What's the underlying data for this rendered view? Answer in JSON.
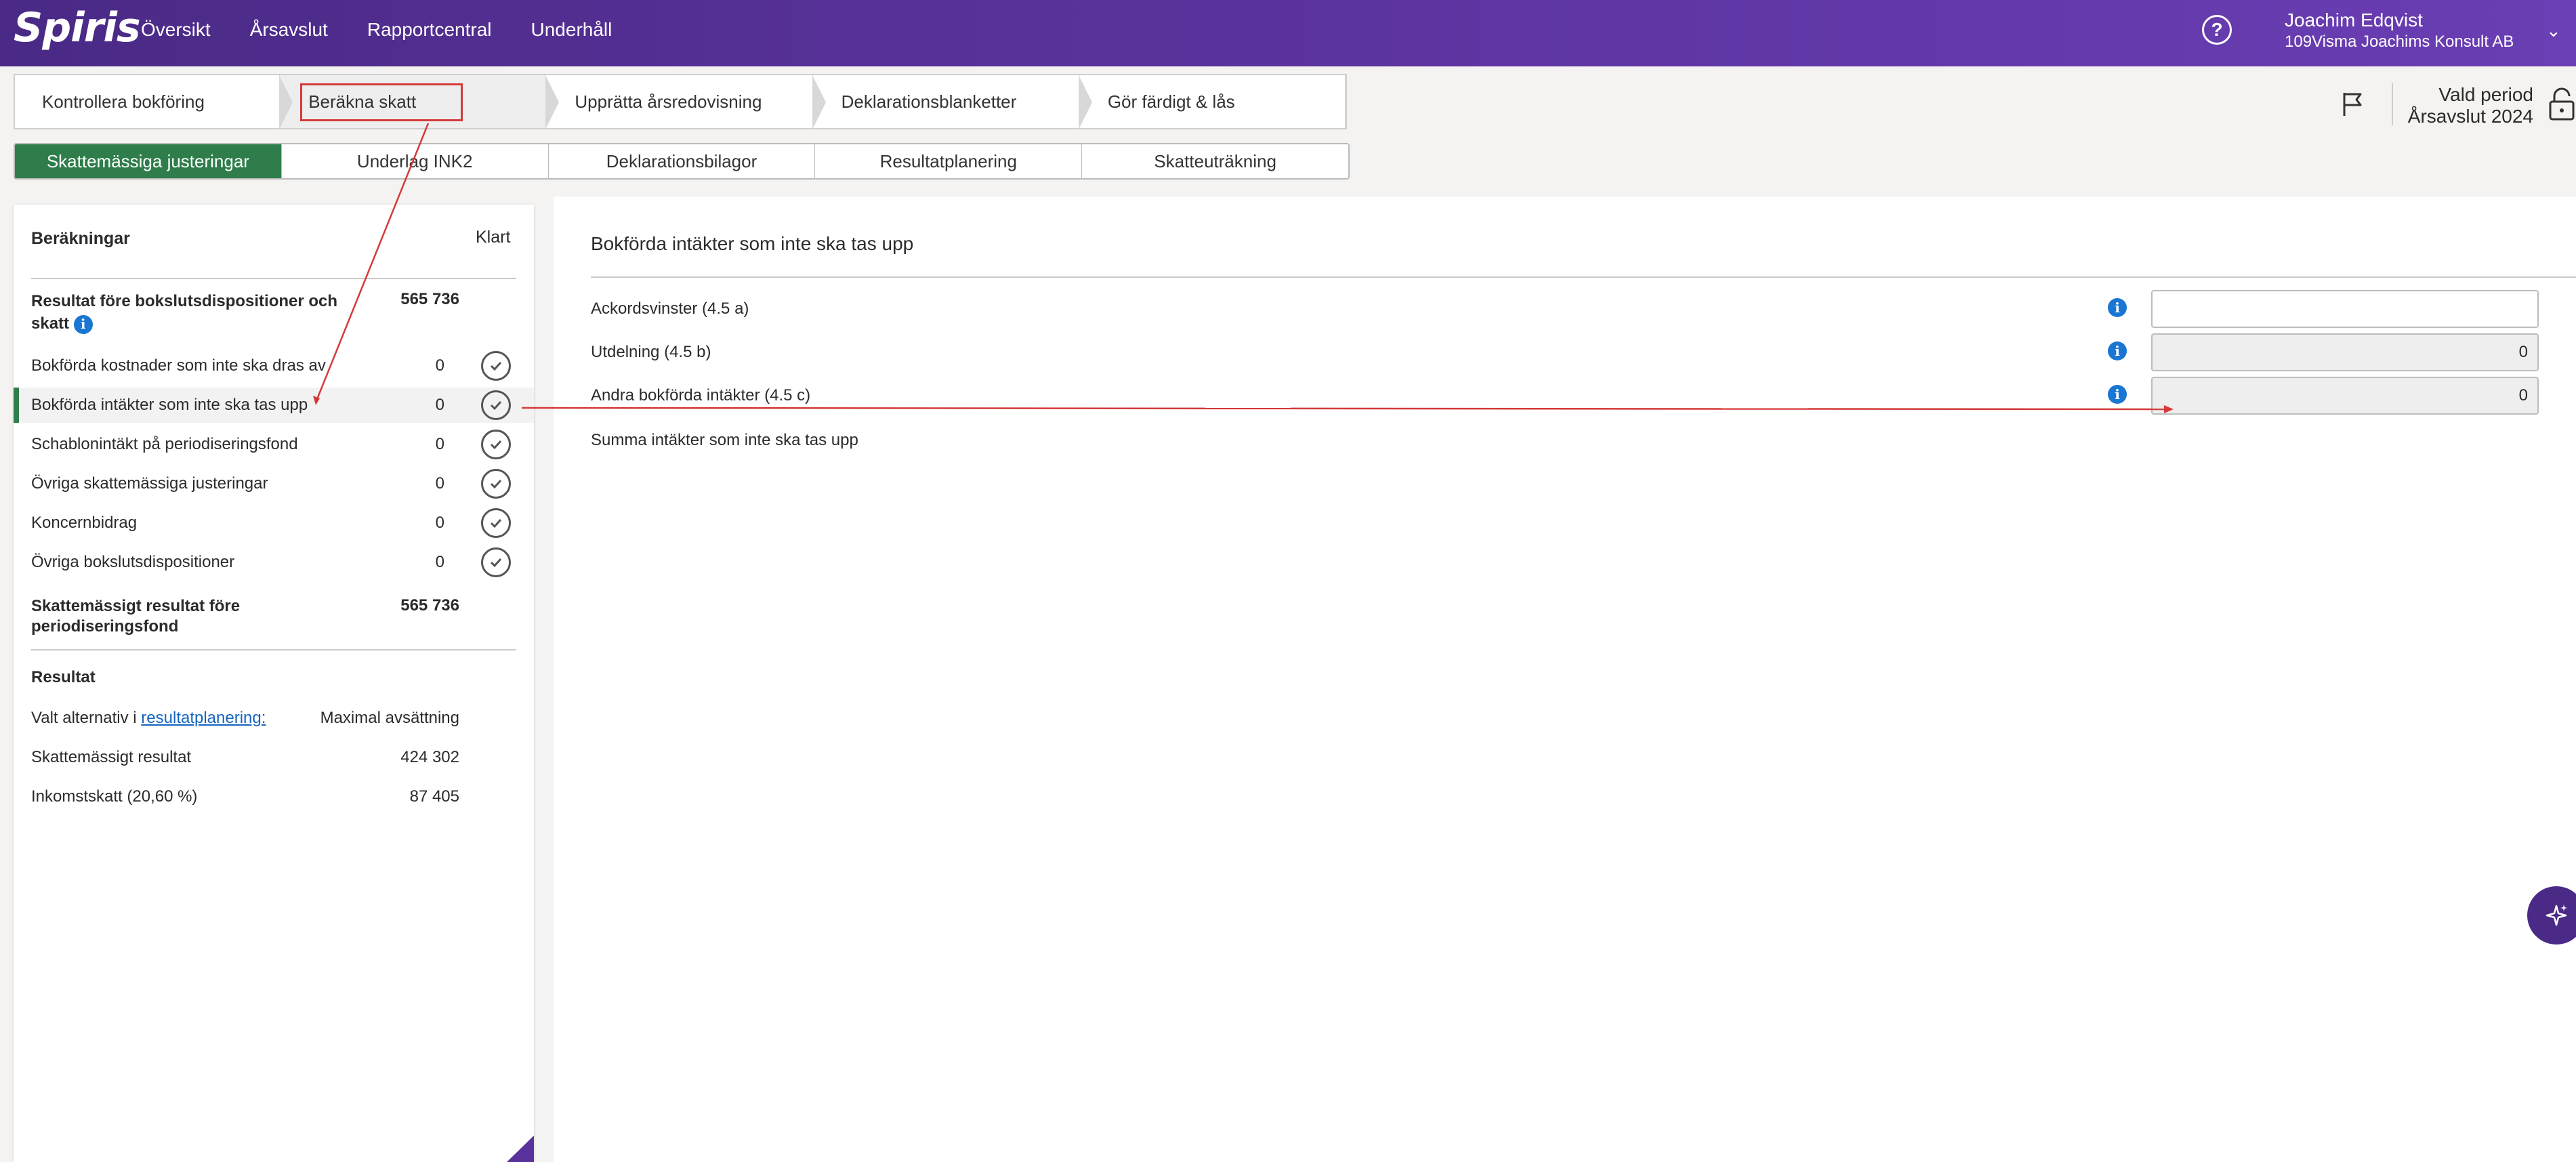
{
  "header": {
    "logo": "Spiris",
    "nav": [
      "Översikt",
      "Årsavslut",
      "Rapportcentral",
      "Underhåll"
    ],
    "user_name": "Joachim Edqvist",
    "company": "109Visma Joachims Konsult AB"
  },
  "stepper": [
    "Kontrollera bokföring",
    "Beräkna skatt",
    "Upprätta årsredovisning",
    "Deklarationsblanketter",
    "Gör färdigt & lås"
  ],
  "subtabs": [
    "Skattemässiga justeringar",
    "Underlag INK2",
    "Deklarationsbilagor",
    "Resultatplanering",
    "Skatteuträkning"
  ],
  "period": {
    "label": "Vald period",
    "value": "Årsavslut 2024"
  },
  "left": {
    "title": "Beräkningar",
    "done_label": "Klart",
    "result_before": {
      "label_line1": "Resultat före bokslutsdispositioner och",
      "label_line2": "skatt",
      "value": "565 736"
    },
    "rows": [
      {
        "label": "Bokförda kostnader som inte ska dras av",
        "value": "0"
      },
      {
        "label": "Bokförda intäkter som inte ska tas upp",
        "value": "0"
      },
      {
        "label": "Schablonintäkt på periodiseringsfond",
        "value": "0"
      },
      {
        "label": "Övriga skattemässiga justeringar",
        "value": "0"
      },
      {
        "label": "Koncernbidrag",
        "value": "0"
      },
      {
        "label": "Övriga bokslutsdispositioner",
        "value": "0"
      }
    ],
    "tax_result_before": {
      "label_line1": "Skattemässigt resultat före",
      "label_line2": "periodiseringsfond",
      "value": "565 736"
    },
    "result_section": {
      "title": "Resultat",
      "alt_prefix": "Valt alternativ i ",
      "alt_link": "resultatplanering:",
      "alt_value": "Maximal avsättning",
      "tax_result_label": "Skattemässigt resultat",
      "tax_result_value": "424 302",
      "income_tax_label": "Inkomstskatt (20,60 %)",
      "income_tax_value": "87 405"
    }
  },
  "right": {
    "title": "Bokförda intäkter som inte ska tas upp",
    "fields": [
      {
        "label": "Ackordsvinster (4.5 a)",
        "value": ""
      },
      {
        "label": "Utdelning (4.5 b)",
        "value": "0"
      },
      {
        "label": "Andra bokförda intäkter (4.5 c)",
        "value": "0"
      }
    ],
    "sum_label": "Summa intäkter som inte ska tas upp"
  },
  "colors": {
    "brand": "#5a329c",
    "accent": "#2e7d4a",
    "annotation": "#d43a3a",
    "info": "#1976d2"
  }
}
